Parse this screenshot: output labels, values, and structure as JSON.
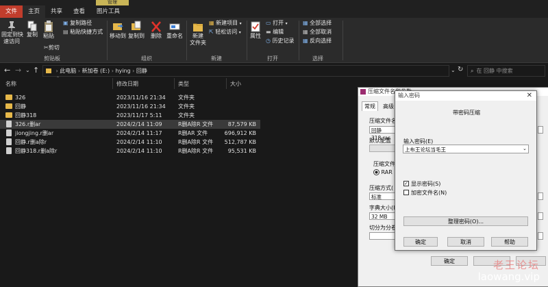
{
  "ribbon": {
    "manage": "管理",
    "tabs": [
      "文件",
      "主页",
      "共享",
      "查看",
      "图片工具"
    ],
    "pin": "固定到快\n速访问",
    "copy": "复制",
    "paste": "粘贴",
    "copy_path": "复制路径",
    "paste_shortcut": "粘贴快捷方式",
    "cut": "剪切",
    "clipboard": "剪贴板",
    "move_to": "移动到",
    "copy_to": "复制到",
    "delete": "删除",
    "rename": "重命名",
    "organize": "组织",
    "new_folder": "新建\n文件夹",
    "new_item": "新建项目",
    "easy_access": "轻松访问",
    "new": "新建",
    "properties": "属性",
    "open": "打开",
    "edit": "编辑",
    "history": "历史记录",
    "open_group": "打开",
    "select_all": "全部选择",
    "select_none": "全部取消",
    "invert": "反向选择",
    "select_group": "选择"
  },
  "address": {
    "crumbs": [
      "此电脑",
      "新加卷 (E:)",
      "hying",
      "回静"
    ],
    "search_placeholder": "在 回静 中搜索"
  },
  "columns": [
    "名称",
    "修改日期",
    "类型",
    "大小"
  ],
  "files": [
    {
      "name": "326",
      "date": "2023/11/16 21:34",
      "type": "文件夹",
      "size": "",
      "kind": "folder"
    },
    {
      "name": "回静",
      "date": "2023/11/16 21:34",
      "type": "文件夹",
      "size": "",
      "kind": "folder"
    },
    {
      "name": "回静318",
      "date": "2023/11/17 5:11",
      "type": "文件夹",
      "size": "",
      "kind": "folder"
    },
    {
      "name": "326.r删ar",
      "date": "2024/2/14 11:09",
      "type": "R删A除R 文件",
      "size": "87,579 KB",
      "kind": "file"
    },
    {
      "name": "jiongjing.r删ar",
      "date": "2024/2/14 11:17",
      "type": "R删AR 文件",
      "size": "696,912 KB",
      "kind": "file"
    },
    {
      "name": "回静.r删a除r",
      "date": "2024/2/14 11:10",
      "type": "R删A除R 文件",
      "size": "512,787 KB",
      "kind": "file"
    },
    {
      "name": "回静318.r删a除r",
      "date": "2024/2/14 11:10",
      "type": "R删A除R 文件",
      "size": "95,531 KB",
      "kind": "file"
    }
  ],
  "rar_dialog": {
    "title": "压缩文件名和参数",
    "tab_general": "常规",
    "tab_advanced": "高级",
    "archive_name_label": "压缩文件名",
    "archive_name": "回静318.rar",
    "default_config": "默认配置",
    "format_label": "压缩文件格",
    "format_rar": "RAR",
    "method_label": "压缩方式(",
    "method": "标准",
    "dict_label": "字典大小(I",
    "dict": "32 MB",
    "split_label": "切分为分卷",
    "ok": "确定"
  },
  "pwd_dialog": {
    "title": "输入密码",
    "heading": "带密码压缩",
    "label": "输入密码(E)",
    "value": "上布王论坛当毛王",
    "show_password": "显示密码(S)",
    "encrypt_names": "加密文件名(N)",
    "organize": "整理密码(O)...",
    "ok": "确定",
    "cancel": "取消",
    "help": "帮助"
  },
  "watermark": {
    "cn": "老王论坛",
    "en": "laowang.vip"
  }
}
